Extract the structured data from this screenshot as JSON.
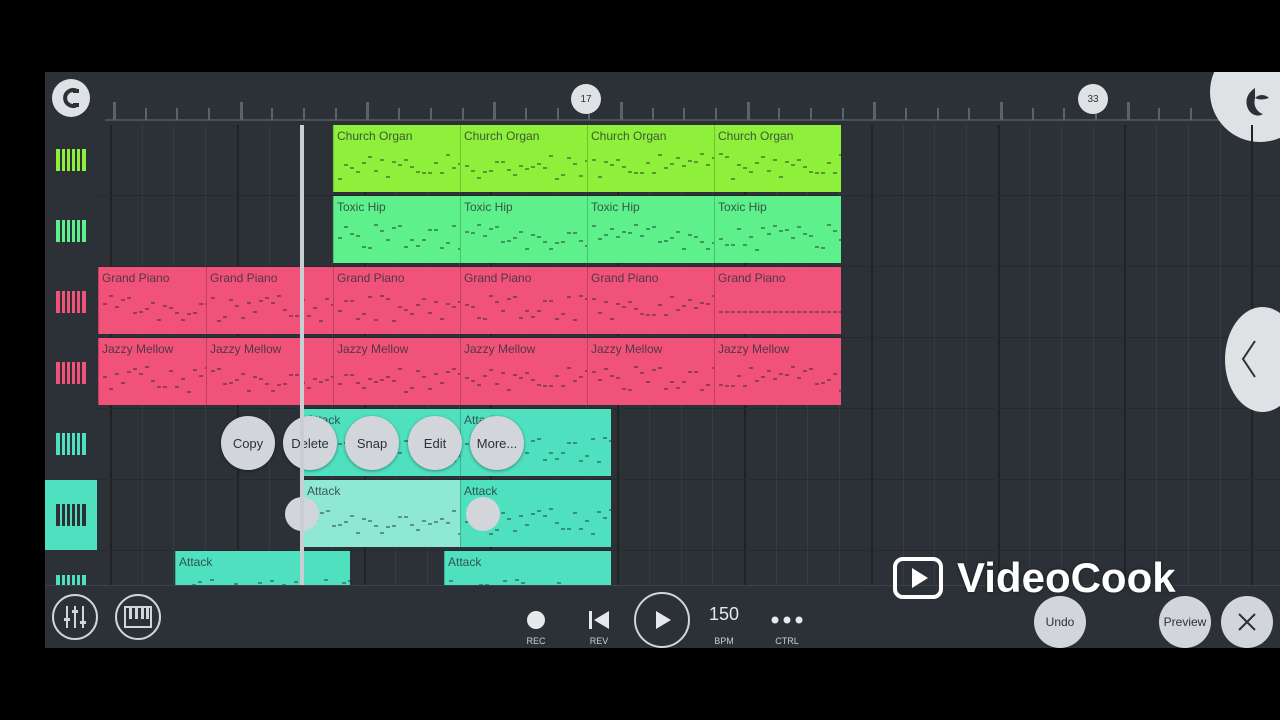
{
  "ruler": {
    "markers": [
      "17",
      "33"
    ]
  },
  "tracks": [
    {
      "name": "Church Organ",
      "color": "#8ef03a"
    },
    {
      "name": "Toxic Hip",
      "color": "#5ef08a"
    },
    {
      "name": "Grand Piano",
      "color": "#f0527a"
    },
    {
      "name": "Jazzy Mellow",
      "color": "#f0527a"
    },
    {
      "name": "Attack",
      "color": "#4fe0c0"
    },
    {
      "name": "Attack",
      "color": "#4fe0c0"
    },
    {
      "name": "Attack",
      "color": "#4fe0c0"
    }
  ],
  "clips": {
    "row0": [
      "Church Organ",
      "Church Organ",
      "Church Organ",
      "Church Organ"
    ],
    "row1": [
      "Toxic Hip",
      "Toxic Hip",
      "Toxic Hip",
      "Toxic Hip"
    ],
    "row2": [
      "Grand Piano",
      "Grand Piano",
      "Grand Piano",
      "Grand Piano",
      "Grand Piano",
      "Grand Piano"
    ],
    "row3": [
      "Jazzy Mellow",
      "Jazzy Mellow",
      "Jazzy Mellow",
      "Jazzy Mellow",
      "Jazzy Mellow",
      "Jazzy Mellow"
    ],
    "row4": [
      "Attack",
      "Attack"
    ],
    "row5": [
      "Attack",
      "Attack"
    ],
    "row6": [
      "Attack",
      "Attack"
    ]
  },
  "context_menu": {
    "copy": "Copy",
    "delete": "Delete",
    "snap": "Snap",
    "edit": "Edit",
    "more": "More..."
  },
  "transport": {
    "rec": "REC",
    "rev": "REV",
    "bpm_value": "150",
    "bpm_label": "BPM",
    "ctrl": "CTRL",
    "undo": "Undo",
    "preview": "Preview"
  },
  "watermark": "VideoCook"
}
